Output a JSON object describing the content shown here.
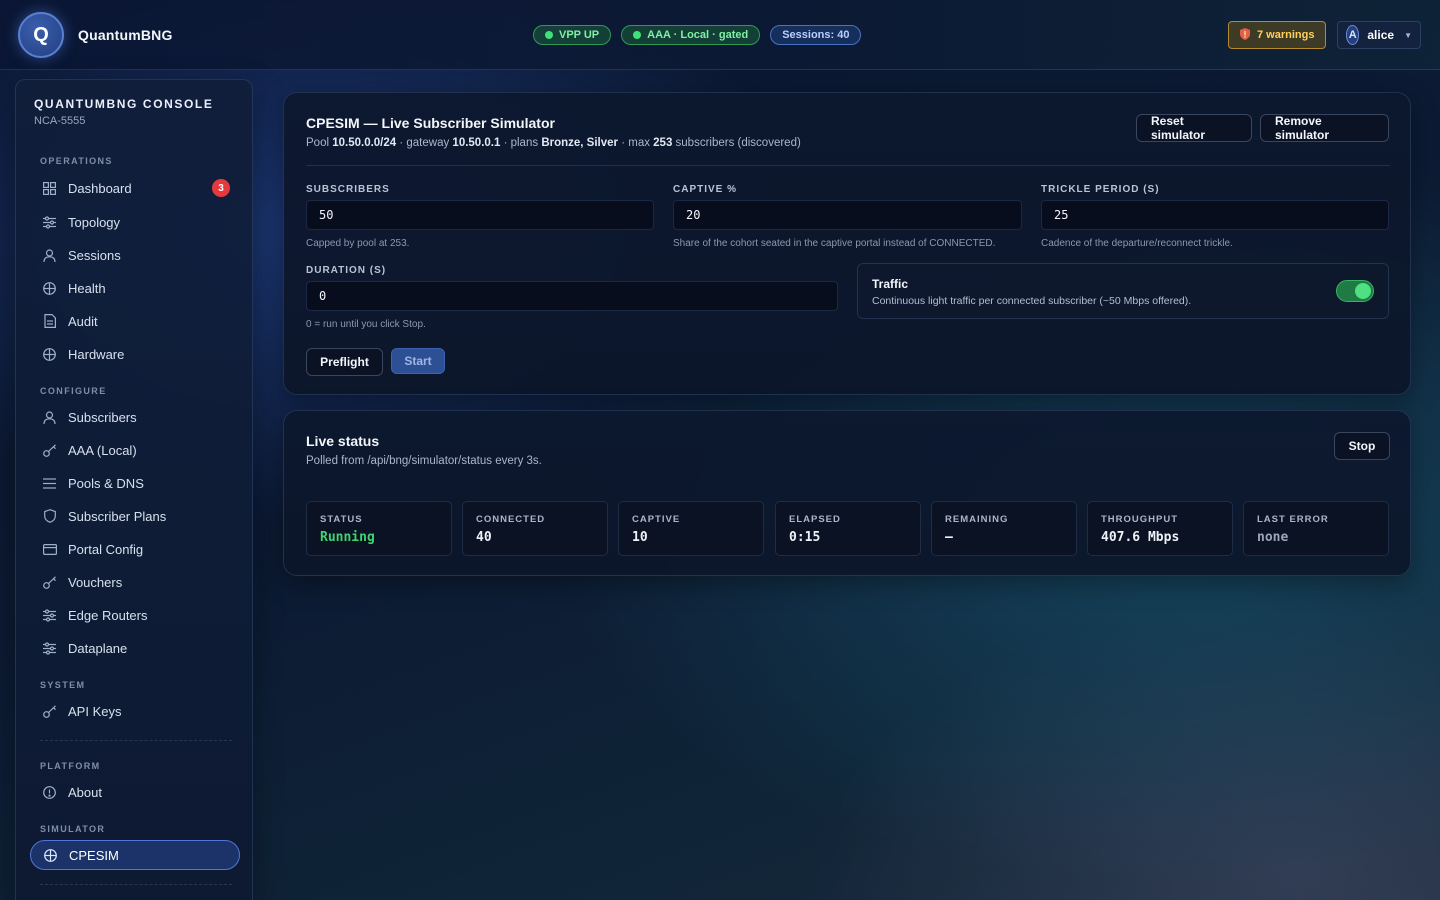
{
  "header": {
    "logo_letter": "Q",
    "brand": "QuantumBNG",
    "pills": [
      {
        "label": "VPP UP"
      },
      {
        "label": "AAA · Local · gated"
      },
      {
        "label": "Sessions: 40"
      }
    ],
    "warnings": "7 warnings",
    "user": {
      "initial": "A",
      "name": "alice"
    }
  },
  "sidebar": {
    "title": "QUANTUMBNG CONSOLE",
    "subtitle": "NCA-5555",
    "sections": {
      "operations": "OPERATIONS",
      "configure": "CONFIGURE",
      "system": "SYSTEM",
      "platform": "PLATFORM",
      "simulator": "SIMULATOR"
    },
    "operations": [
      {
        "label": "Dashboard",
        "icon": "grid-icon",
        "badge": "3"
      },
      {
        "label": "Topology",
        "icon": "sliders-icon"
      },
      {
        "label": "Sessions",
        "icon": "user-icon"
      },
      {
        "label": "Health",
        "icon": "globe-icon"
      },
      {
        "label": "Audit",
        "icon": "document-icon"
      },
      {
        "label": "Hardware",
        "icon": "globe-icon"
      }
    ],
    "configure": [
      {
        "label": "Subscribers",
        "icon": "user-icon"
      },
      {
        "label": "AAA (Local)",
        "icon": "key-icon"
      },
      {
        "label": "Pools & DNS",
        "icon": "list-icon"
      },
      {
        "label": "Subscriber Plans",
        "icon": "shield-icon"
      },
      {
        "label": "Portal Config",
        "icon": "card-icon"
      },
      {
        "label": "Vouchers",
        "icon": "key-icon"
      },
      {
        "label": "Edge Routers",
        "icon": "sliders-icon"
      },
      {
        "label": "Dataplane",
        "icon": "sliders-icon"
      }
    ],
    "system": [
      {
        "label": "API Keys",
        "icon": "key-icon"
      }
    ],
    "platform": [
      {
        "label": "About",
        "icon": "info-icon"
      }
    ],
    "simulator": [
      {
        "label": "CPESIM",
        "icon": "globe-icon",
        "active": true
      }
    ]
  },
  "simulator_card": {
    "title": "CPESIM — Live Subscriber Simulator",
    "sub": {
      "pool_prefix": "Pool ",
      "pool": "10.50.0.0/24",
      "gateway_prefix": " · gateway ",
      "gateway": "10.50.0.1",
      "plans_prefix": " · plans ",
      "plans": "Bronze, Silver",
      "max_prefix": " · max ",
      "max": "253",
      "max_suffix": " subscribers (discovered)"
    },
    "reset_button": "Reset simulator",
    "remove_button": "Remove simulator",
    "fields": {
      "subscribers": {
        "label": "SUBSCRIBERS",
        "value": "50",
        "hint": "Capped by pool at 253."
      },
      "captive": {
        "label": "CAPTIVE %",
        "value": "20",
        "hint": "Share of the cohort seated in the captive portal instead of CONNECTED."
      },
      "trickle": {
        "label": "TRICKLE PERIOD (S)",
        "value": "25",
        "hint": "Cadence of the departure/reconnect trickle."
      },
      "duration": {
        "label": "DURATION (S)",
        "value": "0",
        "hint": "0 = run until you click Stop."
      }
    },
    "traffic": {
      "title": "Traffic",
      "description": "Continuous light traffic per connected subscriber (~50 Mbps offered).",
      "enabled": true
    },
    "preflight_button": "Preflight",
    "start_button": "Start"
  },
  "status_card": {
    "title": "Live status",
    "sub": "Polled from /api/bng/simulator/status every 3s.",
    "stop_button": "Stop",
    "stats": [
      {
        "label": "STATUS",
        "value": "Running"
      },
      {
        "label": "CONNECTED",
        "value": "40"
      },
      {
        "label": "CAPTIVE",
        "value": "10"
      },
      {
        "label": "ELAPSED",
        "value": "0:15"
      },
      {
        "label": "REMAINING",
        "value": "—"
      },
      {
        "label": "THROUGHPUT",
        "value": "407.6 Mbps"
      },
      {
        "label": "LAST ERROR",
        "value": "none"
      }
    ]
  }
}
